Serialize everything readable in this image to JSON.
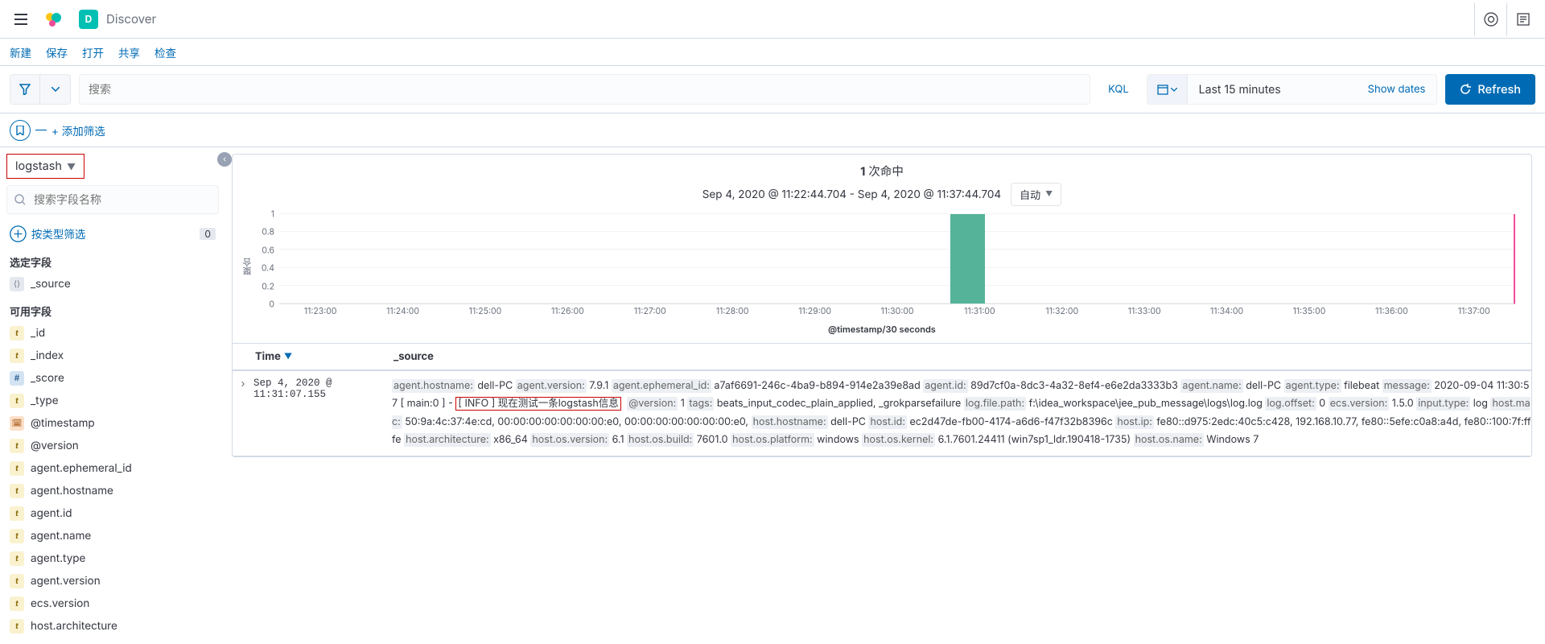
{
  "topbar": {
    "app_badge_letter": "D",
    "title": "Discover"
  },
  "subbar": {
    "new": "新建",
    "save": "保存",
    "open": "打开",
    "share": "共享",
    "inspect": "检查"
  },
  "querybar": {
    "search_placeholder": "搜索",
    "kql": "KQL",
    "daterange": "Last 15 minutes",
    "show_dates": "Show dates",
    "refresh": "Refresh"
  },
  "filterrow": {
    "add_filter": "+ 添加筛选"
  },
  "sidebar": {
    "index_pattern": "logstash",
    "field_search_placeholder": "搜索字段名称",
    "filter_by_type": "按类型筛选",
    "filter_by_type_count": "0",
    "selected_heading": "选定字段",
    "available_heading": "可用字段",
    "selected": [
      {
        "name": "_source",
        "ftype": "s",
        "glyph": "⟨⟩"
      }
    ],
    "available": [
      {
        "name": "_id",
        "ftype": "t",
        "glyph": "t"
      },
      {
        "name": "_index",
        "ftype": "t",
        "glyph": "t"
      },
      {
        "name": "_score",
        "ftype": "n",
        "glyph": "#"
      },
      {
        "name": "_type",
        "ftype": "t",
        "glyph": "t"
      },
      {
        "name": "@timestamp",
        "ftype": "d",
        "glyph": "🗓"
      },
      {
        "name": "@version",
        "ftype": "t",
        "glyph": "t"
      },
      {
        "name": "agent.ephemeral_id",
        "ftype": "t",
        "glyph": "t"
      },
      {
        "name": "agent.hostname",
        "ftype": "t",
        "glyph": "t"
      },
      {
        "name": "agent.id",
        "ftype": "t",
        "glyph": "t"
      },
      {
        "name": "agent.name",
        "ftype": "t",
        "glyph": "t"
      },
      {
        "name": "agent.type",
        "ftype": "t",
        "glyph": "t"
      },
      {
        "name": "agent.version",
        "ftype": "t",
        "glyph": "t"
      },
      {
        "name": "ecs.version",
        "ftype": "t",
        "glyph": "t"
      },
      {
        "name": "host.architecture",
        "ftype": "t",
        "glyph": "t"
      }
    ]
  },
  "hits": {
    "count": "1",
    "label": "次命中",
    "range_text": "Sep 4, 2020 @ 11:22:44.704 - Sep 4, 2020 @ 11:37:44.704",
    "interval_label": "自动"
  },
  "chart_data": {
    "type": "bar",
    "ylabel": "聚合",
    "xlabel": "@timestamp/30 seconds",
    "yticks": [
      0,
      0.2,
      0.4,
      0.6,
      0.8,
      1
    ],
    "ylim": [
      0,
      1
    ],
    "x_tick_labels": [
      "11:23:00",
      "11:24:00",
      "11:25:00",
      "11:26:00",
      "11:27:00",
      "11:28:00",
      "11:29:00",
      "11:30:00",
      "11:31:00",
      "11:32:00",
      "11:33:00",
      "11:34:00",
      "11:35:00",
      "11:36:00",
      "11:37:00"
    ],
    "bar": {
      "center_frac": 0.558,
      "width_frac": 0.028,
      "value": 1
    }
  },
  "table": {
    "time_col": "Time",
    "source_col": "_source",
    "rows": [
      {
        "time": "Sep 4, 2020 @ 11:31:07.155",
        "kv": [
          {
            "k": "agent.hostname:",
            "v": "dell-PC"
          },
          {
            "k": "agent.version:",
            "v": "7.9.1"
          },
          {
            "k": "agent.ephemeral_id:",
            "v": "a7af6691-246c-4ba9-b894-914e2a39e8ad"
          },
          {
            "k": "agent.id:",
            "v": "89d7cf0a-8dc3-4a32-8ef4-e6e2da3333b3"
          },
          {
            "k": "agent.name:",
            "v": "dell-PC"
          },
          {
            "k": "agent.type:",
            "v": "filebeat"
          },
          {
            "k": "message:",
            "v": "2020-09-04 11:30:57 [ main:0 ] - "
          },
          {
            "hl": "[ INFO ] 现在测试一条logstash信息"
          },
          {
            "k": "@version:",
            "v": "1"
          },
          {
            "k": "tags:",
            "v": "beats_input_codec_plain_applied, _grokparsefailure"
          },
          {
            "k": "log.file.path:",
            "v": "f:\\idea_workspace\\jee_pub_message\\logs\\log.log"
          },
          {
            "k": "log.offset:",
            "v": "0"
          },
          {
            "k": "ecs.version:",
            "v": "1.5.0"
          },
          {
            "k": "input.type:",
            "v": "log"
          },
          {
            "k": "host.mac:",
            "v": "50:9a:4c:37:4e:cd, 00:00:00:00:00:00:00:e0, 00:00:00:00:00:00:00:e0,"
          },
          {
            "k": "host.hostname:",
            "v": "dell-PC"
          },
          {
            "k": "host.id:",
            "v": "ec2d47de-fb00-4174-a6d6-f47f32b8396c"
          },
          {
            "k": "host.ip:",
            "v": "fe80::d975:2edc:40c5:c428, 192.168.10.77, fe80::5efe:c0a8:a4d, fe80::100:7f:fffe"
          },
          {
            "k": "host.architecture:",
            "v": "x86_64"
          },
          {
            "k": "host.os.version:",
            "v": "6.1"
          },
          {
            "k": "host.os.build:",
            "v": "7601.0"
          },
          {
            "k": "host.os.platform:",
            "v": "windows"
          },
          {
            "k": "host.os.kernel:",
            "v": "6.1.7601.24411 (win7sp1_ldr.190418-1735)"
          },
          {
            "k": "host.os.name:",
            "v": "Windows 7"
          }
        ]
      }
    ]
  }
}
